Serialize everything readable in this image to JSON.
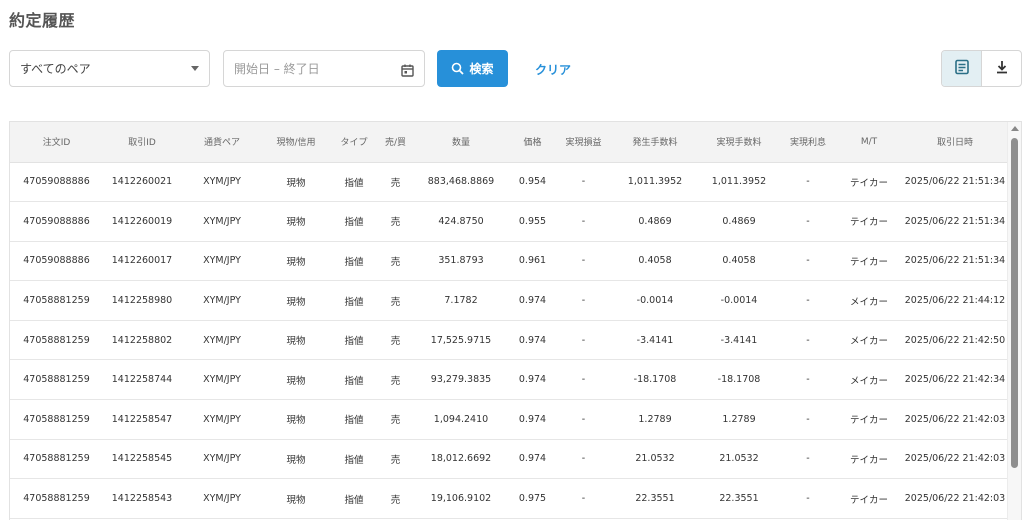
{
  "page": {
    "title": "約定履歴"
  },
  "filters": {
    "pair_select": {
      "value": "すべてのペア"
    },
    "date_range": {
      "placeholder": "開始日 – 終了日"
    },
    "search_label": "検索",
    "clear_label": "クリア"
  },
  "icons": {
    "caret": "chevron-down-icon",
    "calendar": "calendar-icon",
    "search": "search-icon",
    "list_view": "list-view-icon",
    "download": "download-icon"
  },
  "colors": {
    "accent": "#2790d9",
    "header_bg": "#f3f3f3",
    "active_toggle": "#e3eff3"
  },
  "table": {
    "columns": [
      "注文ID",
      "取引ID",
      "通貨ペア",
      "現物/信用",
      "タイプ",
      "売/買",
      "数量",
      "価格",
      "実現損益",
      "発生手数料",
      "実現手数料",
      "実現利息",
      "M/T",
      "取引日時"
    ],
    "rows": [
      [
        "47059088886",
        "1412260021",
        "XYM/JPY",
        "現物",
        "指値",
        "売",
        "883,468.8869",
        "0.954",
        "-",
        "1,011.3952",
        "1,011.3952",
        "-",
        "テイカー",
        "2025/06/22 21:51:34"
      ],
      [
        "47059088886",
        "1412260019",
        "XYM/JPY",
        "現物",
        "指値",
        "売",
        "424.8750",
        "0.955",
        "-",
        "0.4869",
        "0.4869",
        "-",
        "テイカー",
        "2025/06/22 21:51:34"
      ],
      [
        "47059088886",
        "1412260017",
        "XYM/JPY",
        "現物",
        "指値",
        "売",
        "351.8793",
        "0.961",
        "-",
        "0.4058",
        "0.4058",
        "-",
        "テイカー",
        "2025/06/22 21:51:34"
      ],
      [
        "47058881259",
        "1412258980",
        "XYM/JPY",
        "現物",
        "指値",
        "売",
        "7.1782",
        "0.974",
        "-",
        "-0.0014",
        "-0.0014",
        "-",
        "メイカー",
        "2025/06/22 21:44:12"
      ],
      [
        "47058881259",
        "1412258802",
        "XYM/JPY",
        "現物",
        "指値",
        "売",
        "17,525.9715",
        "0.974",
        "-",
        "-3.4141",
        "-3.4141",
        "-",
        "メイカー",
        "2025/06/22 21:42:50"
      ],
      [
        "47058881259",
        "1412258744",
        "XYM/JPY",
        "現物",
        "指値",
        "売",
        "93,279.3835",
        "0.974",
        "-",
        "-18.1708",
        "-18.1708",
        "-",
        "メイカー",
        "2025/06/22 21:42:34"
      ],
      [
        "47058881259",
        "1412258547",
        "XYM/JPY",
        "現物",
        "指値",
        "売",
        "1,094.2410",
        "0.974",
        "-",
        "1.2789",
        "1.2789",
        "-",
        "テイカー",
        "2025/06/22 21:42:03"
      ],
      [
        "47058881259",
        "1412258545",
        "XYM/JPY",
        "現物",
        "指値",
        "売",
        "18,012.6692",
        "0.974",
        "-",
        "21.0532",
        "21.0532",
        "-",
        "テイカー",
        "2025/06/22 21:42:03"
      ],
      [
        "47058881259",
        "1412258543",
        "XYM/JPY",
        "現物",
        "指値",
        "売",
        "19,106.9102",
        "0.975",
        "-",
        "22.3551",
        "22.3551",
        "-",
        "テイカー",
        "2025/06/22 21:42:03"
      ]
    ]
  }
}
